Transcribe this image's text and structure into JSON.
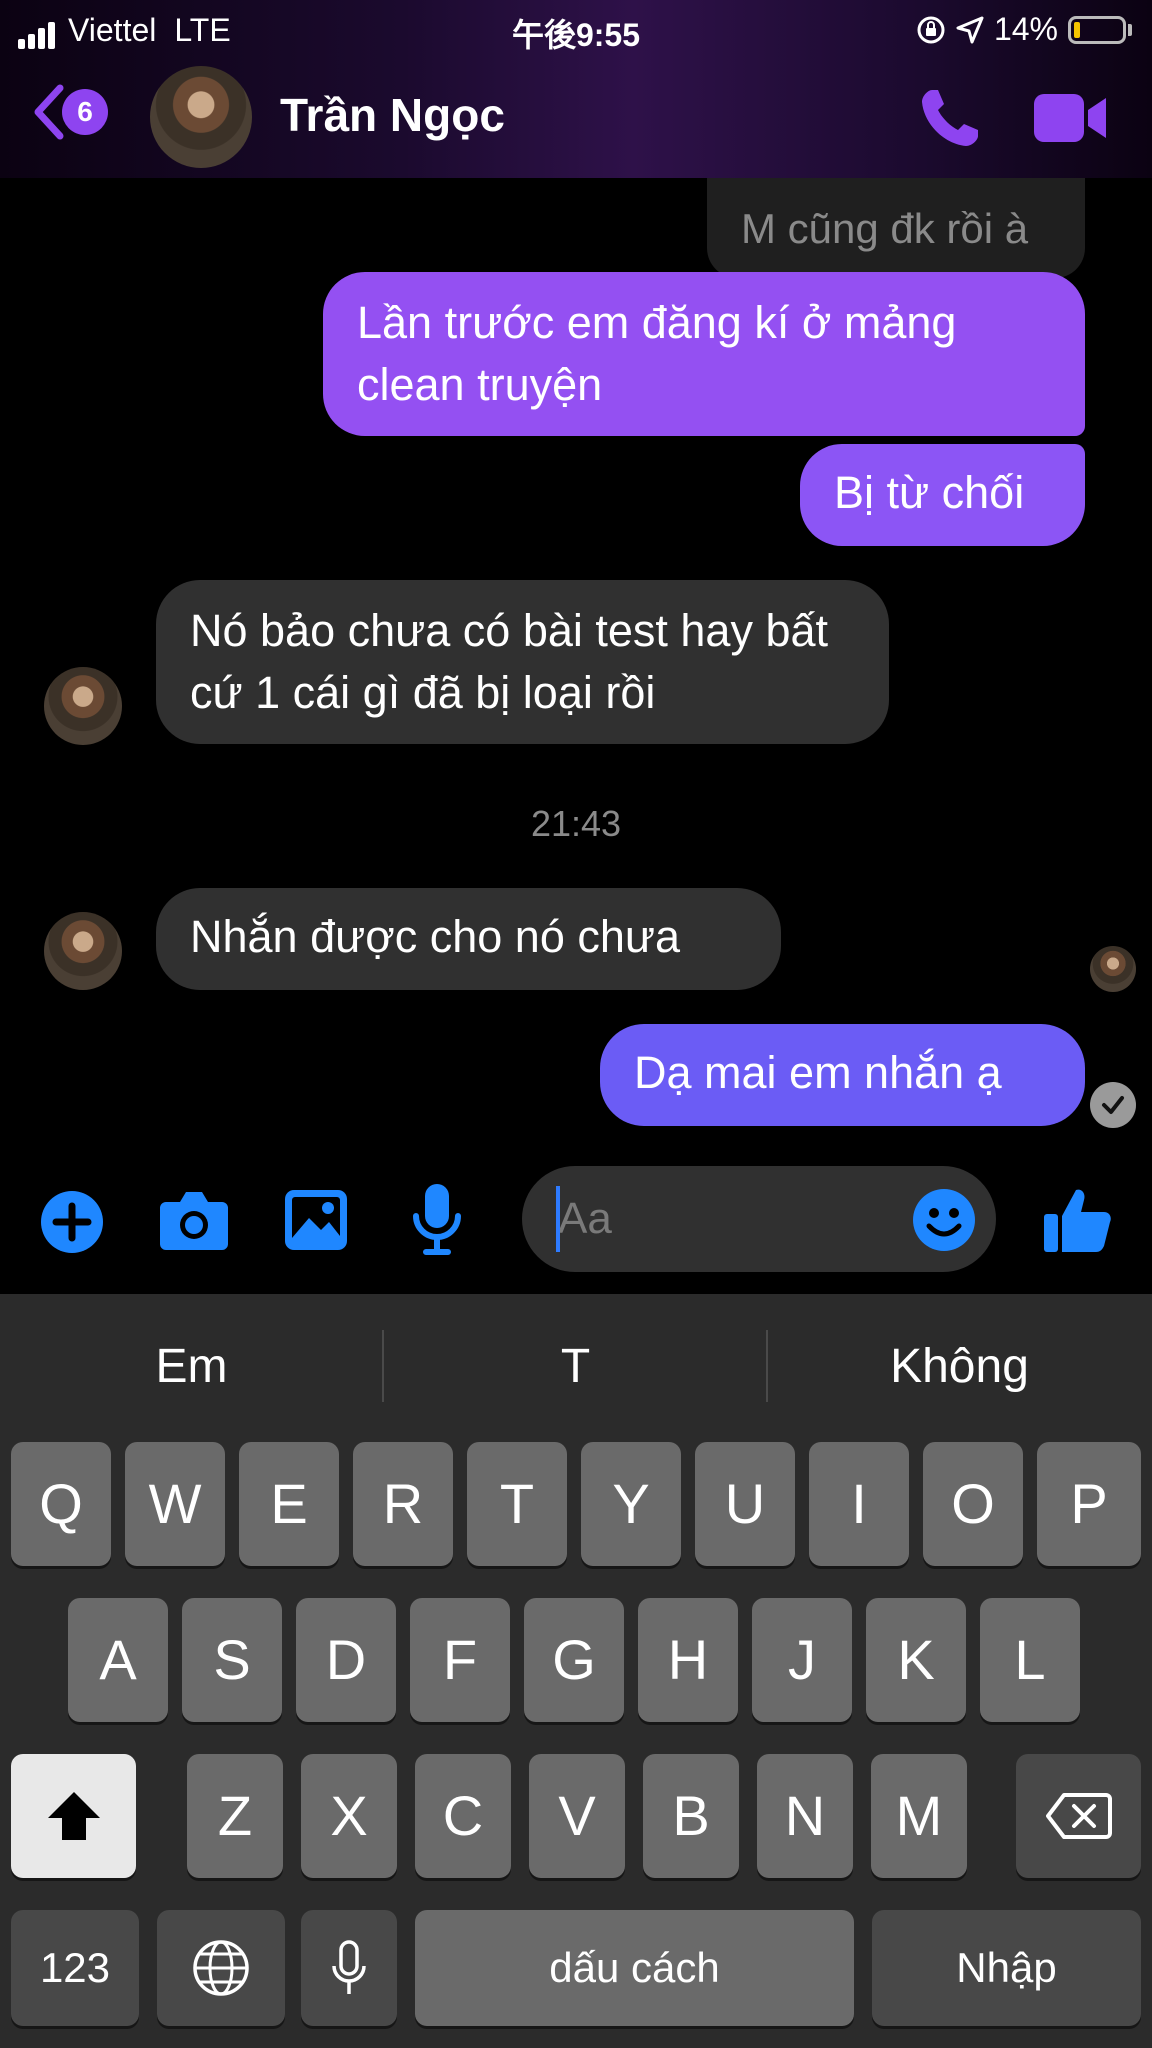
{
  "status": {
    "carrier": "Viettel",
    "network": "LTE",
    "time": "午後9:55",
    "battery": "14%",
    "battery_level": 0.14
  },
  "header": {
    "unread_count": "6",
    "contact_name": "Trần Ngọc"
  },
  "messages": [
    {
      "side": "out",
      "text": "M cũng đk rồi à"
    },
    {
      "side": "out",
      "text": "Lần trước em đăng kí ở mảng clean truyện"
    },
    {
      "side": "out",
      "text": "Bị từ chối"
    },
    {
      "side": "in",
      "text": "Nó bảo chưa có bài test hay bất cứ 1 cái gì đã bị loại rồi"
    },
    {
      "side": "in",
      "text": "Nhắn được cho nó chưa"
    },
    {
      "side": "out",
      "text": "Dạ mai em nhắn ạ"
    }
  ],
  "timestamp": "21:43",
  "composer": {
    "placeholder": "Aa"
  },
  "keyboard": {
    "suggestions": [
      "Em",
      "T",
      "Không"
    ],
    "row1": [
      "Q",
      "W",
      "E",
      "R",
      "T",
      "Y",
      "U",
      "I",
      "O",
      "P"
    ],
    "row2": [
      "A",
      "S",
      "D",
      "F",
      "G",
      "H",
      "J",
      "K",
      "L"
    ],
    "row3": [
      "Z",
      "X",
      "C",
      "V",
      "B",
      "N",
      "M"
    ],
    "numbers_key": "123",
    "space_key": "dấu cách",
    "return_key": "Nhập"
  },
  "colors": {
    "accent": "#8e44f0",
    "bubble_out": "#9450f2",
    "bubble_in": "#303030",
    "icon_blue": "#1f87ff"
  },
  "icons": [
    "back-chevron-icon",
    "phone-icon",
    "video-camera-icon",
    "plus-icon",
    "camera-icon",
    "photo-icon",
    "microphone-icon",
    "emoji-icon",
    "thumbs-up-icon",
    "shift-icon",
    "backspace-icon",
    "globe-icon",
    "dictation-icon",
    "check-icon"
  ]
}
